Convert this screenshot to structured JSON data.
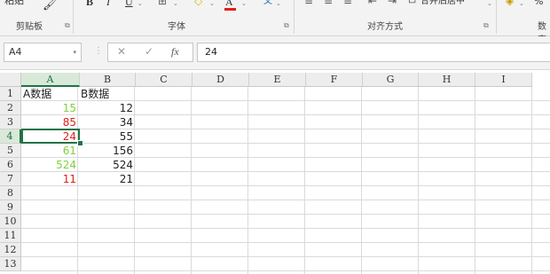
{
  "ribbon": {
    "groups": [
      {
        "label": "剪贴板"
      },
      {
        "label": "字体"
      },
      {
        "label": "对齐方式"
      },
      {
        "label": "数字"
      }
    ],
    "paste_label": "粘贴",
    "bold": "B",
    "italic": "I",
    "underline": "U",
    "font_color": "A",
    "phonetic": "文",
    "merge_center": "合并后居中",
    "percent": "%"
  },
  "formula_bar": {
    "name_box": "A4",
    "cancel": "✕",
    "enter": "✓",
    "fx": "fx",
    "value": "24"
  },
  "sheet": {
    "columns": [
      "A",
      "B",
      "C",
      "D",
      "E",
      "F",
      "G",
      "H",
      "I"
    ],
    "rows": [
      "1",
      "2",
      "3",
      "4",
      "5",
      "6",
      "7",
      "8",
      "9",
      "10",
      "11",
      "12",
      "13"
    ],
    "selected_cell": "A4",
    "colors": {
      "green": "#7ed13b",
      "red": "#e0211b",
      "black": "#222222",
      "accent": "#217346"
    },
    "data": [
      {
        "a": "A数据",
        "b": "B数据"
      },
      {
        "a": "15",
        "a_color": "green",
        "b": "12"
      },
      {
        "a": "85",
        "a_color": "red",
        "b": "34"
      },
      {
        "a": "24",
        "a_color": "red",
        "b": "55"
      },
      {
        "a": "61",
        "a_color": "green",
        "b": "156"
      },
      {
        "a": "524",
        "a_color": "green",
        "b": "524"
      },
      {
        "a": "11",
        "a_color": "red",
        "b": "21"
      }
    ]
  }
}
